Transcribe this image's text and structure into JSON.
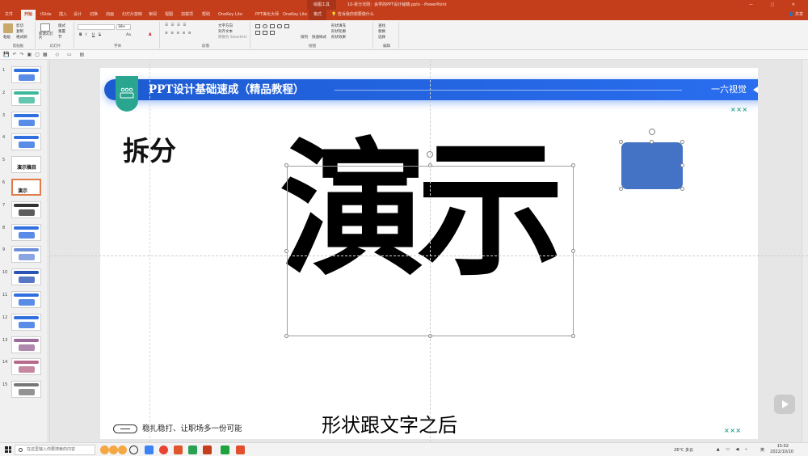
{
  "window": {
    "context_tool": "绘图工具",
    "doc_title": "10-拆分法则：会学的PPT设计秘籍.pptx - PowerPoint",
    "controls": "— ▢ ✕"
  },
  "tabs": [
    "文件",
    "开始",
    "iSlide",
    "插入",
    "设计",
    "切换",
    "动画",
    "幻灯片放映",
    "审阅",
    "视图",
    "加载项",
    "帮助",
    "OneKey Lite",
    "PPT插件(OK)",
    "PPT美化大师",
    "OneKey Lite"
  ],
  "active_tab": "开始",
  "context_tab": "格式",
  "tell_me": "告诉我你想要做什么",
  "share": "共享",
  "ribbon": {
    "clipboard": {
      "label": "剪贴板",
      "paste": "粘贴",
      "cut": "剪切",
      "copy": "复制",
      "format": "格式刷"
    },
    "slides": {
      "label": "幻灯片",
      "new": "新建幻灯片",
      "layout": "版式",
      "reset": "重置",
      "section": "节"
    },
    "font": {
      "label": "字体",
      "size": "18+",
      "bold": "B",
      "italic": "I",
      "underline": "U",
      "strike": "S",
      "case": "Aa",
      "color": "A"
    },
    "paragraph": {
      "label": "段落",
      "dir": "文字方向",
      "align": "对齐文本",
      "smartart": "转换为 SmartArt"
    },
    "drawing": {
      "label": "绘图",
      "arrange": "排列",
      "quick": "快速样式",
      "fill": "形状填充",
      "outline": "形状轮廓",
      "effect": "形状效果"
    },
    "editing": {
      "label": "编辑",
      "find": "查找",
      "replace": "替换",
      "select": "选择"
    }
  },
  "thumbnails": [
    {
      "n": "1"
    },
    {
      "n": "2"
    },
    {
      "n": "3"
    },
    {
      "n": "4"
    },
    {
      "n": "5",
      "text": "演示稿目"
    },
    {
      "n": "6",
      "text": "演示",
      "selected": true
    },
    {
      "n": "7"
    },
    {
      "n": "8"
    },
    {
      "n": "9"
    },
    {
      "n": "10"
    },
    {
      "n": "11"
    },
    {
      "n": "12"
    },
    {
      "n": "13"
    },
    {
      "n": "14"
    },
    {
      "n": "15"
    }
  ],
  "slide": {
    "banner_title": "PPT设计基础速成（精品教程）",
    "banner_right": "一六视觉",
    "decor_x": "×××",
    "heading": "拆分",
    "big_text": "演示",
    "footer": "稳扎稳打、让职场多一份可能",
    "shape_color": "#4472c4",
    "accent_color": "#2aa590",
    "banner_color": "#1d5bd1"
  },
  "subtitle": "形状跟文字之后",
  "taskbar": {
    "search_placeholder": "在这里输入你要搜索的内容",
    "weather": "26°C 多云",
    "time": "15:02",
    "date": "2022/10/10",
    "lang": "英"
  }
}
